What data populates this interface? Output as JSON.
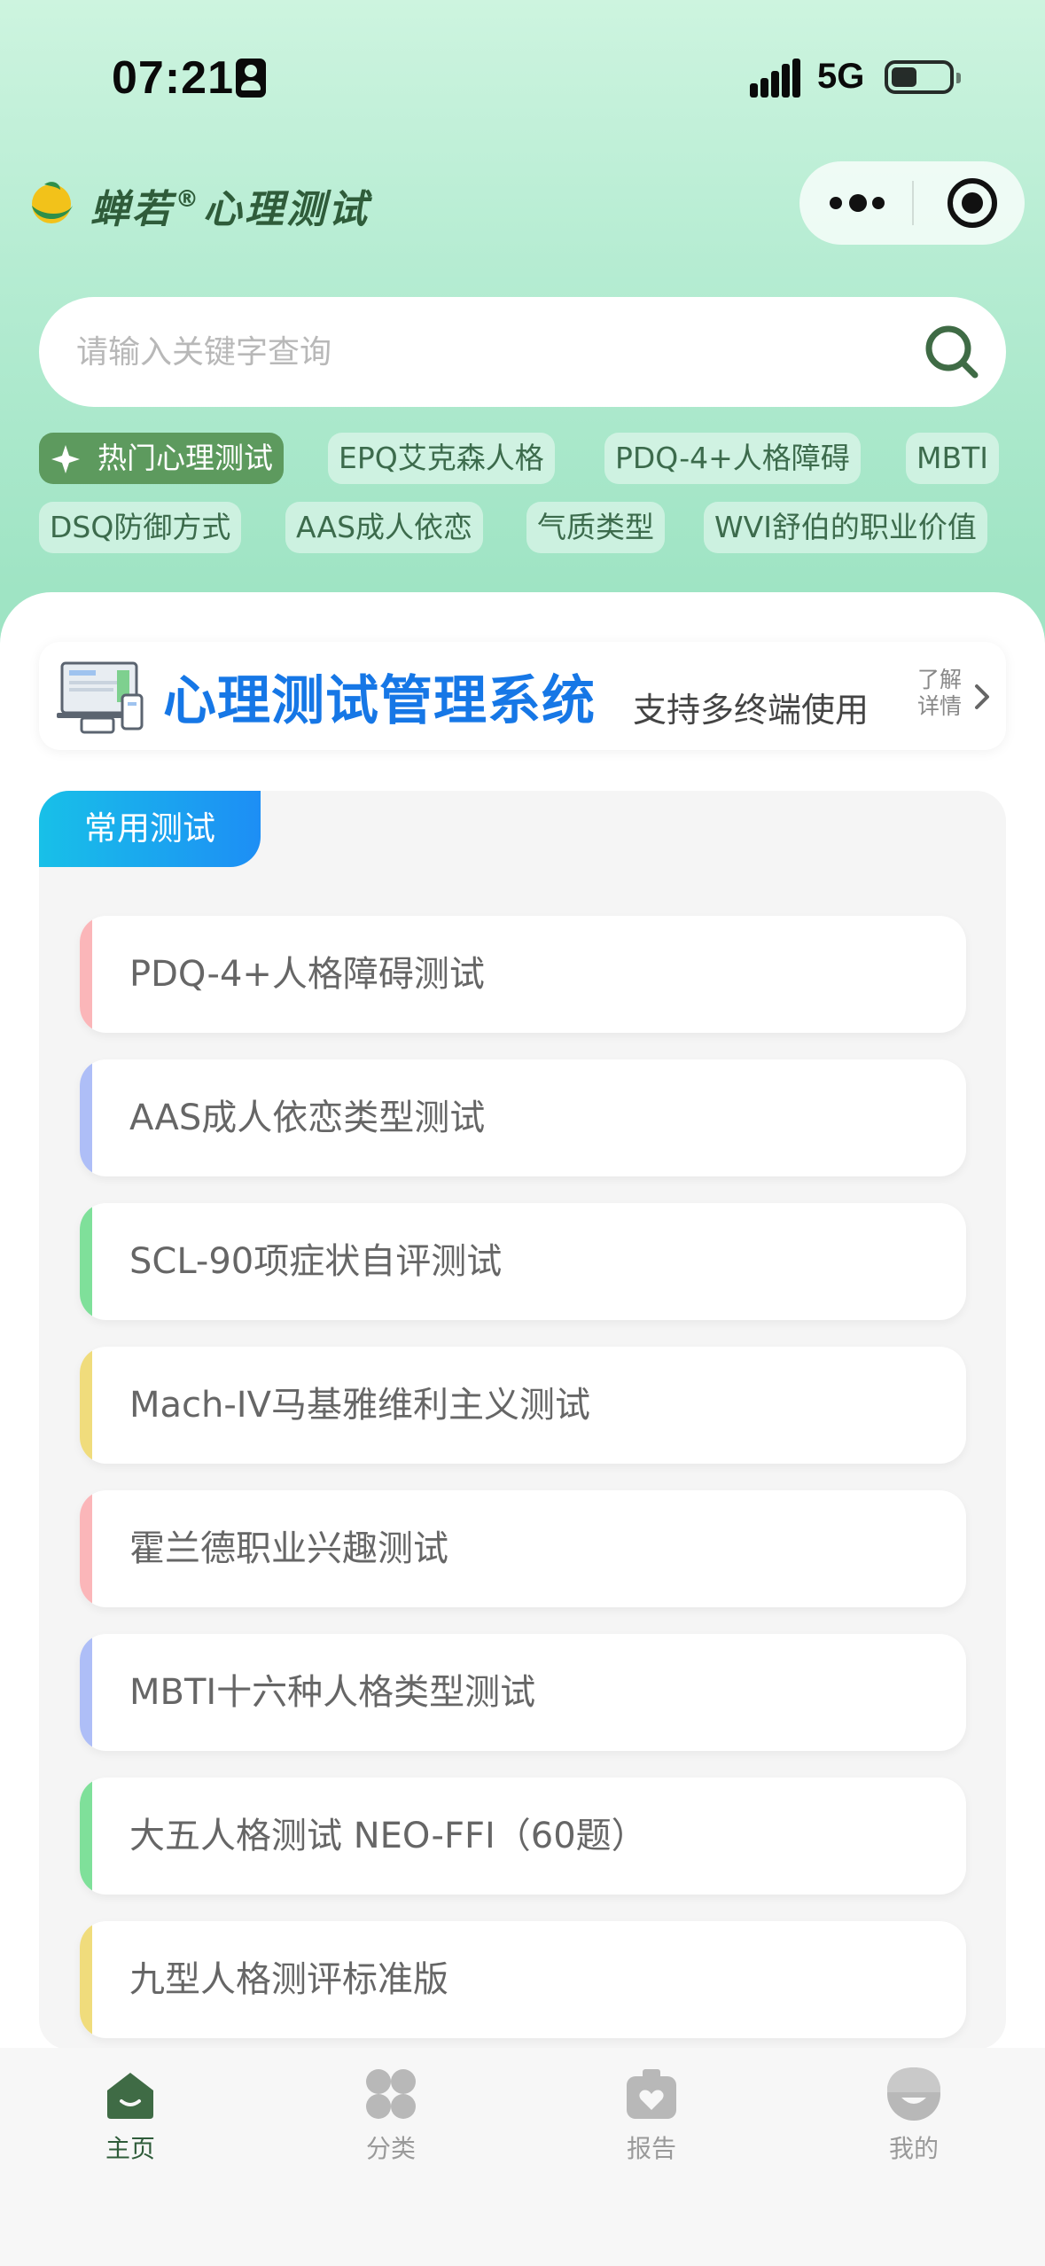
{
  "status_bar": {
    "time": "07:21",
    "network": "5G"
  },
  "header": {
    "app_name_part1": "蝉若",
    "registered_mark": "®",
    "app_name_part2": "心理测试"
  },
  "search": {
    "placeholder": "请输入关键字查询"
  },
  "tags": [
    "热门心理测试",
    "EPQ艾克森人格",
    "PDQ-4+人格障碍",
    "MBTI",
    "DSQ防御方式",
    "AAS成人依恋",
    "气质类型",
    "WVI舒伯的职业价值"
  ],
  "banner": {
    "title": "心理测试管理系统",
    "subtitle": "支持多终端使用",
    "more_line1": "了解",
    "more_line2": "详情"
  },
  "section": {
    "title": "常用测试",
    "items": [
      {
        "label": "PDQ-4+人格障碍测试",
        "accent": "#fbb6b9"
      },
      {
        "label": "AAS成人依恋类型测试",
        "accent": "#aebef7"
      },
      {
        "label": "SCL-90项症状自评测试",
        "accent": "#7fe09a"
      },
      {
        "label": "Mach-IV马基雅维利主义测试",
        "accent": "#f0dc7c"
      },
      {
        "label": "霍兰德职业兴趣测试",
        "accent": "#fbb6b9"
      },
      {
        "label": "MBTI十六种人格类型测试",
        "accent": "#aebef7"
      },
      {
        "label": "大五人格测试 NEO-FFI（60题）",
        "accent": "#7fe09a"
      },
      {
        "label": "九型人格测评标准版",
        "accent": "#f0dc7c"
      }
    ]
  },
  "tabbar": {
    "items": [
      {
        "label": "主页",
        "icon": "home-icon",
        "active": true
      },
      {
        "label": "分类",
        "icon": "category-icon",
        "active": false
      },
      {
        "label": "报告",
        "icon": "report-icon",
        "active": false
      },
      {
        "label": "我的",
        "icon": "profile-icon",
        "active": false
      }
    ]
  },
  "colors": {
    "brand_green": "#2f5c3a",
    "tag_text": "#3c6b4c",
    "hot_tag_bg": "#5d9a5e",
    "banner_blue": "#1677e6",
    "section_tab_gradient": [
      "#18c0e8",
      "#1d8ef5"
    ]
  }
}
